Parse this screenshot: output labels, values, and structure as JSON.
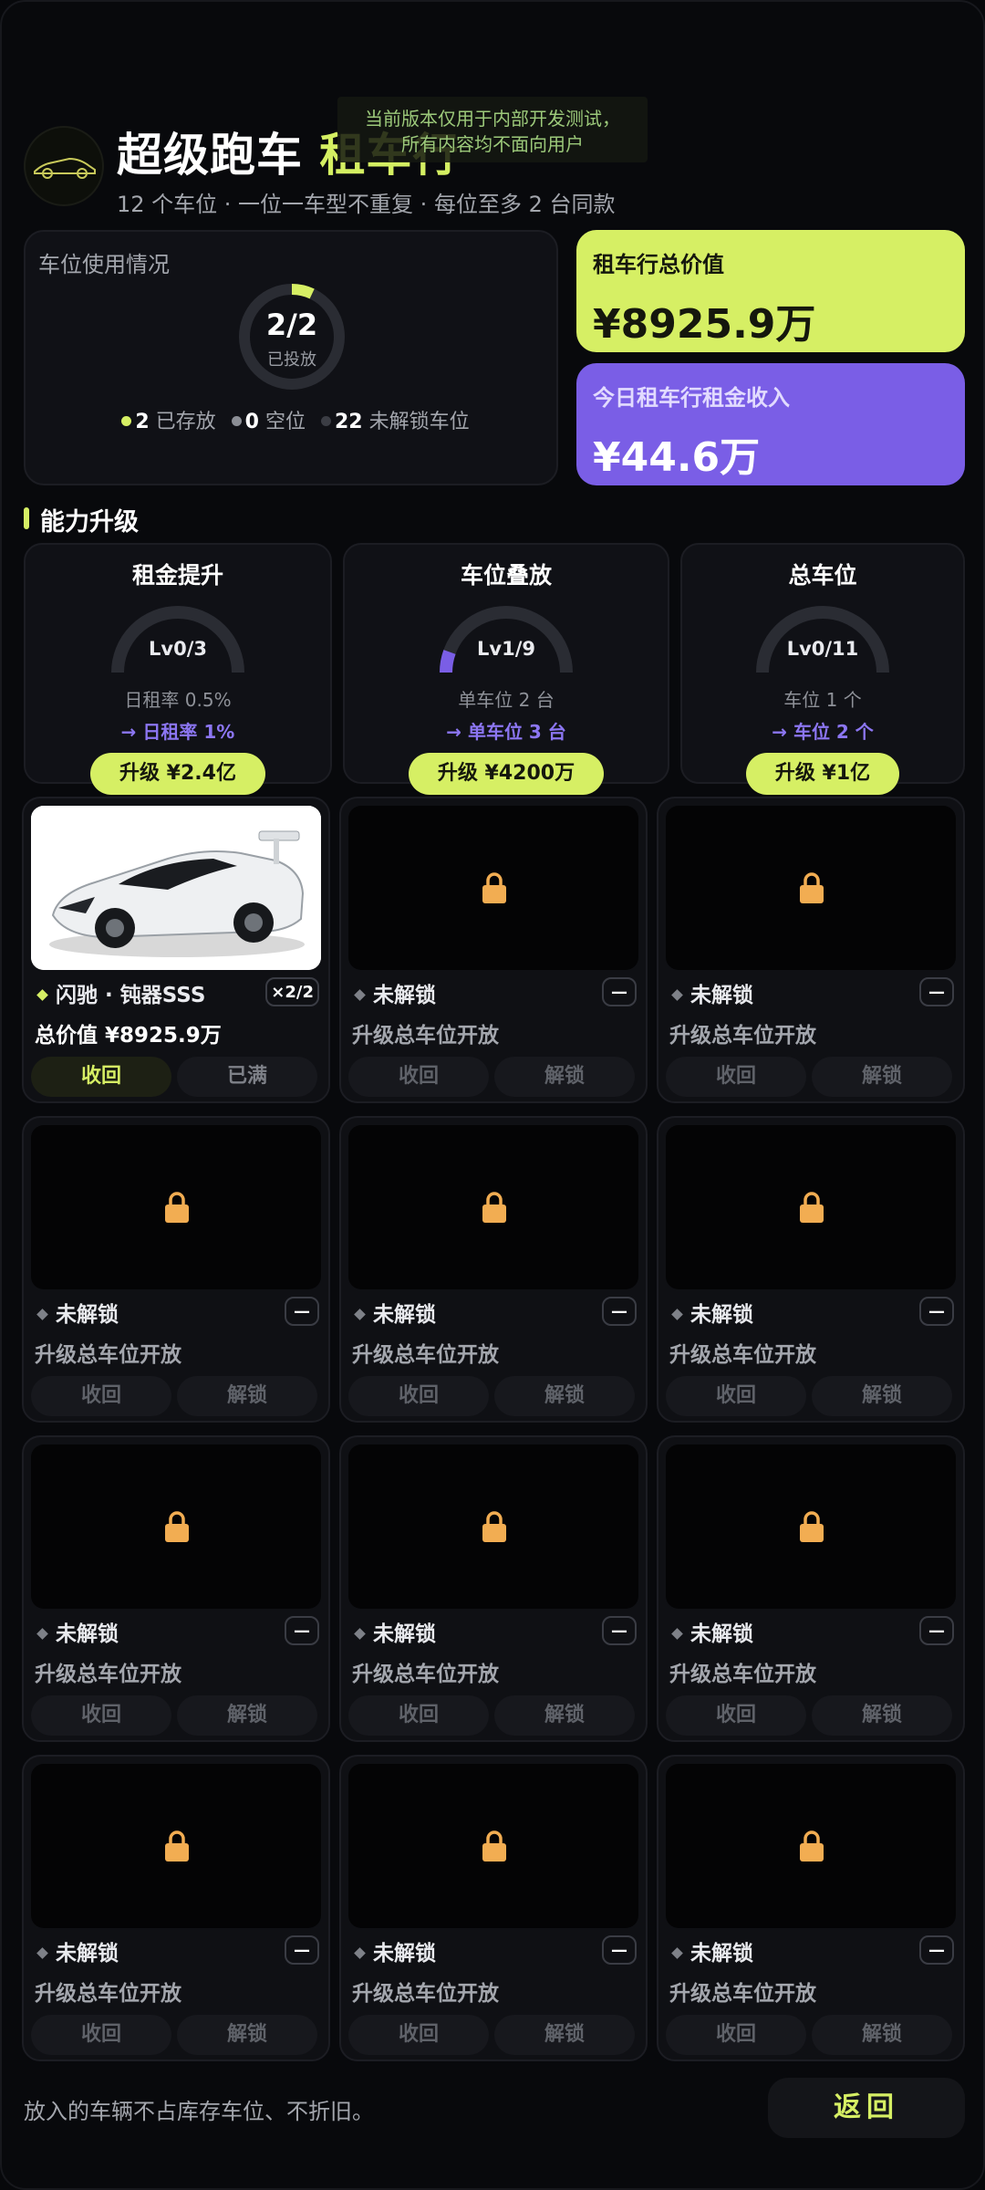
{
  "header": {
    "title_main": "超级跑车",
    "title_highlight": "租车行",
    "subtitle": "12 个车位 · 一位一车型不重复 · 每位至多 2 台同款",
    "dev_notice_line1": "当前版本仅用于内部开发测试，",
    "dev_notice_line2": "所有内容均不面向用户"
  },
  "usage": {
    "label": "车位使用情况",
    "ring_value": "2/2",
    "ring_sub": "已投放",
    "ring_progress": 0.07,
    "legend": [
      {
        "count": "2",
        "text": "已存放",
        "color": "#d6ef64"
      },
      {
        "count": "0",
        "text": "空位",
        "color": "#8b8e95"
      },
      {
        "count": "22",
        "text": "未解锁车位",
        "color": "#3b3d44"
      }
    ]
  },
  "stats": {
    "total_label": "租车行总价值",
    "total_value": "¥8925.9万",
    "income_label": "今日租车行租金收入",
    "income_value": "¥44.6万"
  },
  "upgrade_section_title": "能力升级",
  "upgrades": [
    {
      "name": "租金提升",
      "level": "Lv0/3",
      "progress": 0,
      "current": "日租率 0.5%",
      "next": "→ 日租率 1%",
      "button": "升级 ¥2.4亿"
    },
    {
      "name": "车位叠放",
      "level": "Lv1/9",
      "progress": 0.111,
      "current": "单车位 2 台",
      "next": "→ 单车位 3 台",
      "button": "升级 ¥4200万"
    },
    {
      "name": "总车位",
      "level": "Lv0/11",
      "progress": 0,
      "current": "车位 1 个",
      "next": "→ 车位 2 个",
      "button": "升级 ¥1亿"
    }
  ],
  "slots": [
    {
      "name": "闪驰 · 钝器SSS",
      "badge": "×2/2",
      "desc": "总价值 ¥8925.9万",
      "btn1": "收回",
      "btn2": "已满",
      "owned": true
    },
    {
      "name": "未解锁",
      "badge": "—",
      "desc": "升级总车位开放",
      "btn1": "收回",
      "btn2": "解锁",
      "owned": false
    },
    {
      "name": "未解锁",
      "badge": "—",
      "desc": "升级总车位开放",
      "btn1": "收回",
      "btn2": "解锁",
      "owned": false
    },
    {
      "name": "未解锁",
      "badge": "—",
      "desc": "升级总车位开放",
      "btn1": "收回",
      "btn2": "解锁",
      "owned": false
    },
    {
      "name": "未解锁",
      "badge": "—",
      "desc": "升级总车位开放",
      "btn1": "收回",
      "btn2": "解锁",
      "owned": false
    },
    {
      "name": "未解锁",
      "badge": "—",
      "desc": "升级总车位开放",
      "btn1": "收回",
      "btn2": "解锁",
      "owned": false
    },
    {
      "name": "未解锁",
      "badge": "—",
      "desc": "升级总车位开放",
      "btn1": "收回",
      "btn2": "解锁",
      "owned": false
    },
    {
      "name": "未解锁",
      "badge": "—",
      "desc": "升级总车位开放",
      "btn1": "收回",
      "btn2": "解锁",
      "owned": false
    },
    {
      "name": "未解锁",
      "badge": "—",
      "desc": "升级总车位开放",
      "btn1": "收回",
      "btn2": "解锁",
      "owned": false
    },
    {
      "name": "未解锁",
      "badge": "—",
      "desc": "升级总车位开放",
      "btn1": "收回",
      "btn2": "解锁",
      "owned": false
    },
    {
      "name": "未解锁",
      "badge": "—",
      "desc": "升级总车位开放",
      "btn1": "收回",
      "btn2": "解锁",
      "owned": false
    },
    {
      "name": "未解锁",
      "badge": "—",
      "desc": "升级总车位开放",
      "btn1": "收回",
      "btn2": "解锁",
      "owned": false
    }
  ],
  "footer": {
    "note": "放入的车辆不占库存车位、不折旧。",
    "back": "返回"
  },
  "icons": {
    "slot_lock": "lock-icon",
    "logo": "car-logo-icon"
  },
  "colors": {
    "accent": "#d6ef64",
    "purple": "#7a5ee6",
    "lock": "#f2ad52"
  }
}
